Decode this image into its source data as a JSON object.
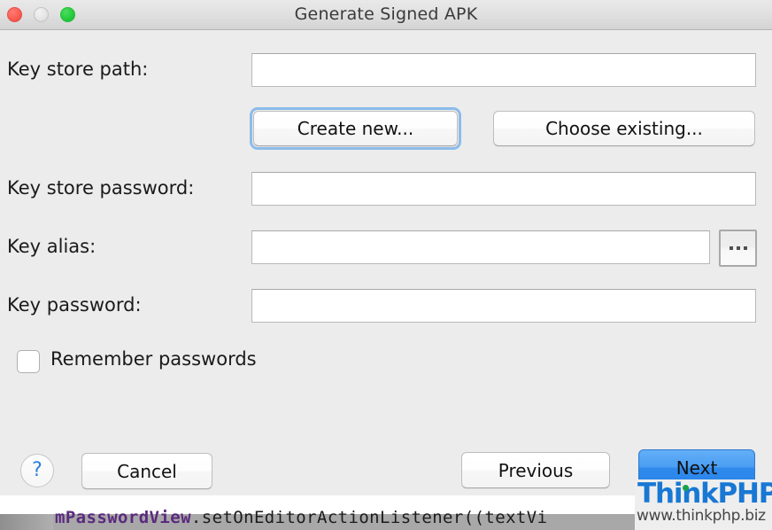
{
  "window": {
    "title": "Generate Signed APK",
    "traffic_lights": [
      {
        "name": "close",
        "color": "#fa5e55",
        "enabled": true
      },
      {
        "name": "minimize",
        "color": "#e4e4e4",
        "enabled": false
      },
      {
        "name": "zoom",
        "color": "#27cc3f",
        "enabled": true
      }
    ],
    "background_color": "#ececec",
    "titlebar_color": "#e0e0e0"
  },
  "form": {
    "fields": [
      {
        "label": "Key store path:",
        "value": "",
        "placeholder": ""
      },
      {
        "label": "Key store password:",
        "value": "",
        "placeholder": ""
      },
      {
        "label": "Key alias:",
        "value": "",
        "placeholder": ""
      },
      {
        "label": "Key password:",
        "value": "",
        "placeholder": ""
      }
    ],
    "keystore_buttons": {
      "create_new": "Create new...",
      "choose_existing": "Choose existing..."
    },
    "alias_browse_label": "...",
    "remember_passwords": {
      "label": "Remember passwords",
      "checked": false
    }
  },
  "footer": {
    "help_label": "?",
    "cancel_label": "Cancel",
    "previous_label": "Previous",
    "next_label": "Next",
    "next_is_default": true,
    "next_color": "#3f93ef"
  },
  "background": {
    "code_line_variable": "mPasswordView",
    "code_line_rest": ".setOnEditorActionListener((textVi"
  },
  "watermark": {
    "brand": "ThinkPHP",
    "url": "www.thinkphp.biz",
    "brand_color": "#1878d4",
    "accent_color": "#18a24a"
  }
}
